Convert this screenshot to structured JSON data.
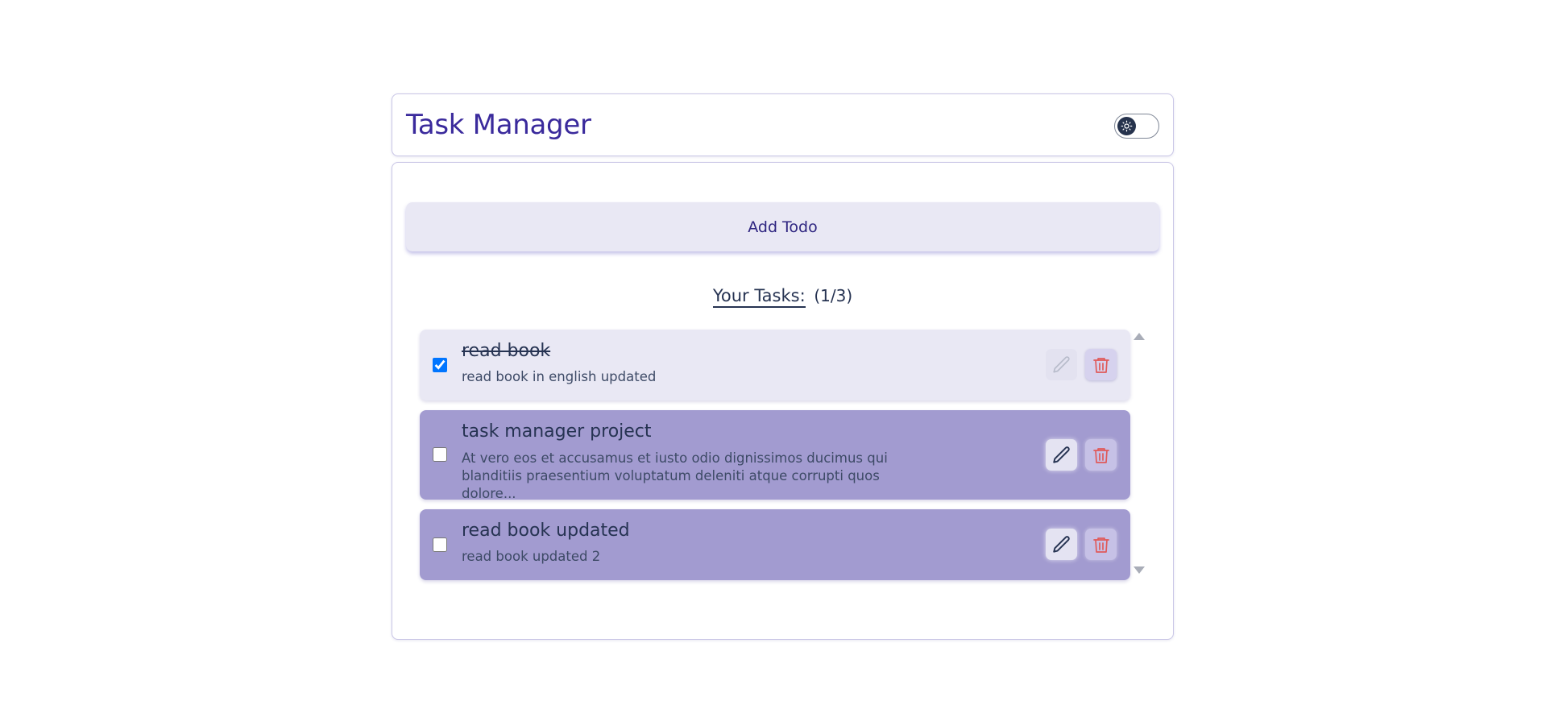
{
  "header": {
    "title": "Task Manager",
    "theme_toggle_icon": "sun-icon"
  },
  "main": {
    "add_todo_label": "Add Todo",
    "tasks_heading": "Your Tasks:",
    "tasks_count": "(1/3)"
  },
  "tasks": [
    {
      "title": "read book",
      "description": "read book in english updated",
      "completed": true,
      "edit_disabled": true
    },
    {
      "title": "task manager project",
      "description": "At vero eos et accusamus et iusto odio dignissimos ducimus qui blanditiis praesentium voluptatum deleniti atque corrupti quos dolore...",
      "completed": false,
      "edit_disabled": false
    },
    {
      "title": "read book updated",
      "description": "read book updated 2",
      "completed": false,
      "edit_disabled": false
    }
  ],
  "colors": {
    "accent": "#3a2a9c",
    "text_primary": "#263352",
    "completed_bg": "#e9e8f4",
    "active_bg": "#a29bd0",
    "delete_red": "#e05a5a"
  }
}
